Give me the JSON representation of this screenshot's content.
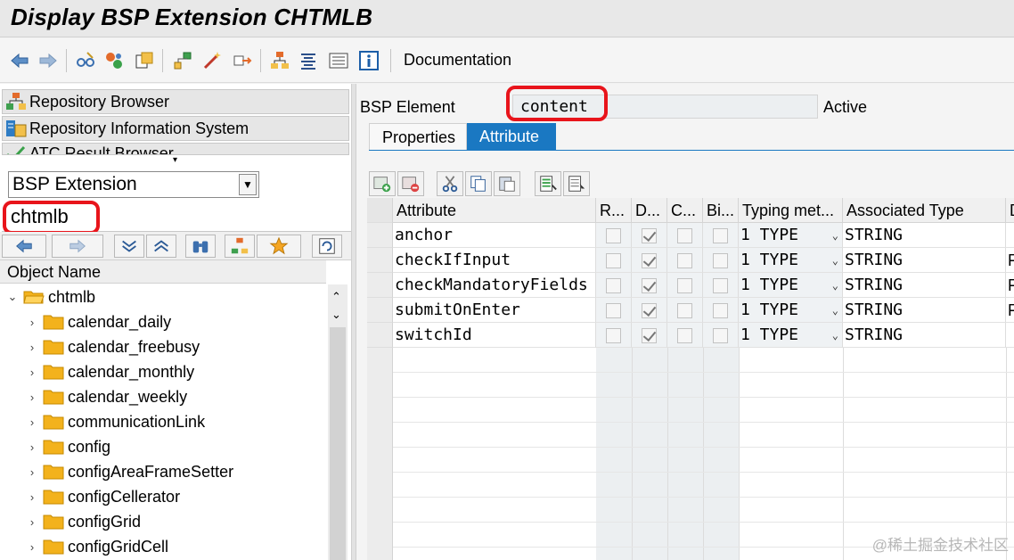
{
  "window": {
    "title": "Display BSP Extension CHTMLB"
  },
  "toolbar": {
    "icons": [
      "back-icon",
      "forward-icon",
      "glasses-icon",
      "activate-icon",
      "object-list-icon",
      "hierarchy-icon",
      "magic-wand-icon",
      "move-icon",
      "tree-icon",
      "align-icon",
      "list-view-icon",
      "info-icon"
    ],
    "documentation_label": "Documentation"
  },
  "left": {
    "nav": [
      {
        "label": "Repository Browser",
        "icon": "repository-browser-icon"
      },
      {
        "label": "Repository Information System",
        "icon": "info-system-icon"
      },
      {
        "label": "ATC Result Browser",
        "icon": "atc-icon"
      }
    ],
    "object_type": {
      "selected": "BSP Extension"
    },
    "search_value": "chtmlb",
    "tree_header": "Object Name",
    "tree": {
      "root": "chtmlb",
      "children": [
        "calendar_daily",
        "calendar_freebusy",
        "calendar_monthly",
        "calendar_weekly",
        "communicationLink",
        "config",
        "configAreaFrameSetter",
        "configCellerator",
        "configGrid",
        "configGridCell"
      ]
    }
  },
  "right": {
    "bsp_element_label": "BSP Element",
    "bsp_element_value": "content",
    "status": "Active",
    "tabs": [
      {
        "label": "Properties",
        "active": false
      },
      {
        "label": "Attribute",
        "active": true
      }
    ],
    "table": {
      "columns": [
        "Attribute",
        "R...",
        "D...",
        "C...",
        "Bi...",
        "Typing met...",
        "Associated Type",
        "D"
      ],
      "rows": [
        {
          "attribute": "anchor",
          "r": false,
          "d": true,
          "c": false,
          "bi": false,
          "typing": "1 TYPE",
          "assoc": "STRING",
          "extra": ""
        },
        {
          "attribute": "checkIfInput",
          "r": false,
          "d": true,
          "c": false,
          "bi": false,
          "typing": "1 TYPE",
          "assoc": "STRING",
          "extra": "F"
        },
        {
          "attribute": "checkMandatoryFields",
          "r": false,
          "d": true,
          "c": false,
          "bi": false,
          "typing": "1 TYPE",
          "assoc": "STRING",
          "extra": "F"
        },
        {
          "attribute": "submitOnEnter",
          "r": false,
          "d": true,
          "c": false,
          "bi": false,
          "typing": "1 TYPE",
          "assoc": "STRING",
          "extra": "F"
        },
        {
          "attribute": "switchId",
          "r": false,
          "d": true,
          "c": false,
          "bi": false,
          "typing": "1 TYPE",
          "assoc": "STRING",
          "extra": ""
        }
      ]
    }
  },
  "watermark": "@稀土掘金技术社区",
  "colors": {
    "accent": "#1a78c2",
    "highlight_ring": "#e8141b",
    "folder": "#f3b21c"
  }
}
